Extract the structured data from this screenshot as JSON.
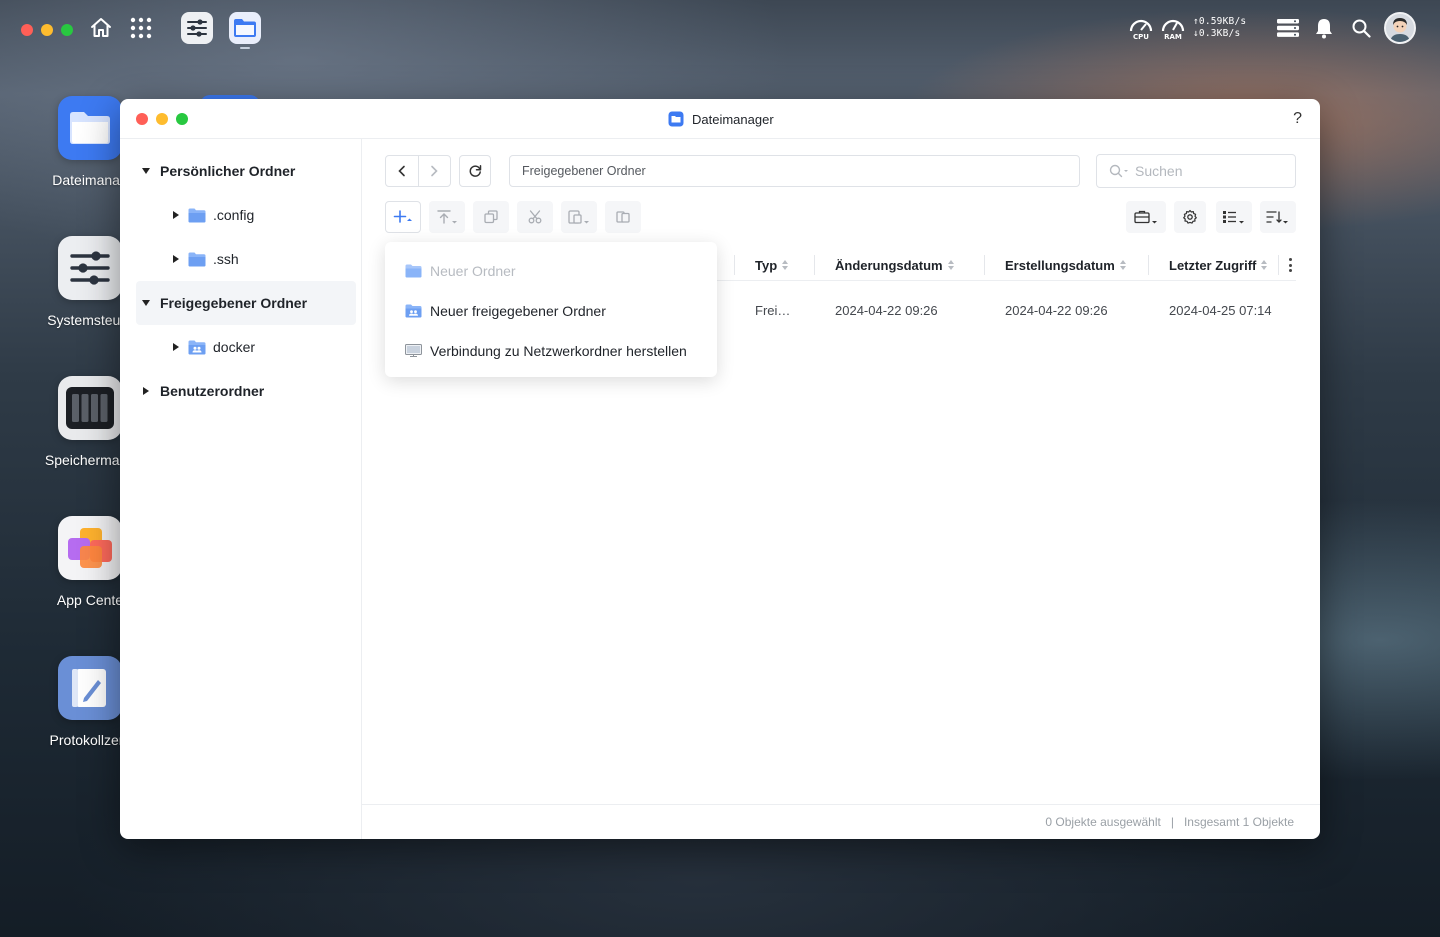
{
  "topbar": {
    "cpu_label": "CPU",
    "ram_label": "RAM",
    "net_up": "0.59KB/s",
    "net_down": "0.3KB/s"
  },
  "desktop": {
    "items": [
      {
        "label": "Dateimanag"
      },
      {
        "label": "Systemsteuer"
      },
      {
        "label": "Speichermana"
      },
      {
        "label": "App Cente"
      },
      {
        "label": "Protokollzent"
      }
    ]
  },
  "window": {
    "title": "Dateimanager",
    "help": "?"
  },
  "sidebar": {
    "personal": "Persönlicher Ordner",
    "config": ".config",
    "ssh": ".ssh",
    "shared": "Freigegebener Ordner",
    "docker": "docker",
    "users": "Benutzerordner"
  },
  "toolbar": {
    "path": "Freigegebener Ordner",
    "search_placeholder": "Suchen"
  },
  "table": {
    "headers": {
      "type": "Typ",
      "modified": "Änderungsdatum",
      "created": "Erstellungsdatum",
      "accessed": "Letzter Zugriff"
    },
    "rows": [
      {
        "type": "Frei…",
        "modified": "2024-04-22 09:26",
        "created": "2024-04-22 09:26",
        "accessed": "2024-04-25 07:14"
      }
    ]
  },
  "dropdown": {
    "new_folder": "Neuer Ordner",
    "new_shared_folder": "Neuer freigegebener Ordner",
    "connect_network": "Verbindung zu Netzwerkordner herstellen"
  },
  "footer": {
    "selected": "0 Objekte ausgewählt",
    "divider": "|",
    "total": "Insgesamt 1 Objekte"
  },
  "colors": {
    "accent": "#3d7af2",
    "folder": "#8ab4f8"
  }
}
